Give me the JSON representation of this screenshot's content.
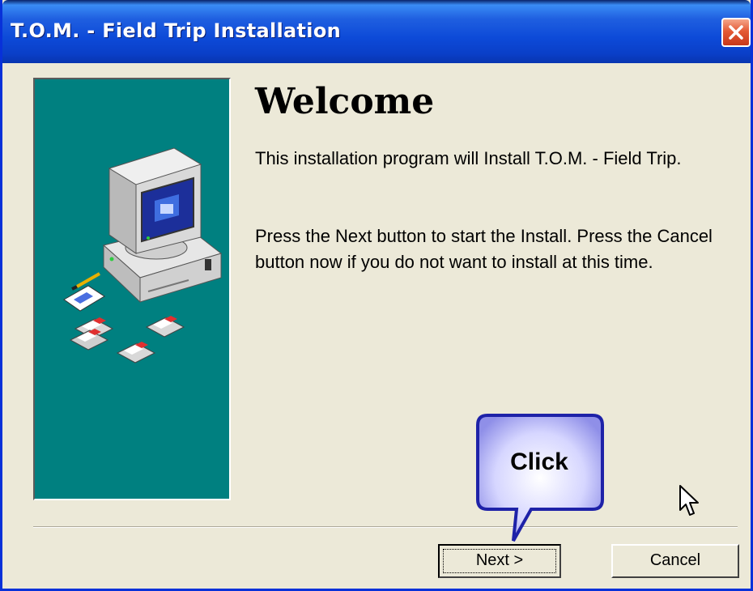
{
  "window": {
    "title": "T.O.M. - Field Trip Installation"
  },
  "content": {
    "heading": "Welcome",
    "paragraph1": "This installation program will Install  T.O.M. - Field Trip.",
    "paragraph2": "Press the Next button to start the Install.  Press the Cancel button now if you do not want to install at this time."
  },
  "buttons": {
    "next_label": "Next >",
    "cancel_label": "Cancel"
  },
  "callout": {
    "text": "Click"
  },
  "colors": {
    "titlebar": "#0d4ad8",
    "side_panel": "#008080",
    "dialog_bg": "#ece9d8",
    "close_button": "#e45a35"
  },
  "icons": [
    "close-icon",
    "computer-illustration",
    "notepad-pencil-icon",
    "floppy-disk-icon",
    "mouse-cursor-icon"
  ]
}
